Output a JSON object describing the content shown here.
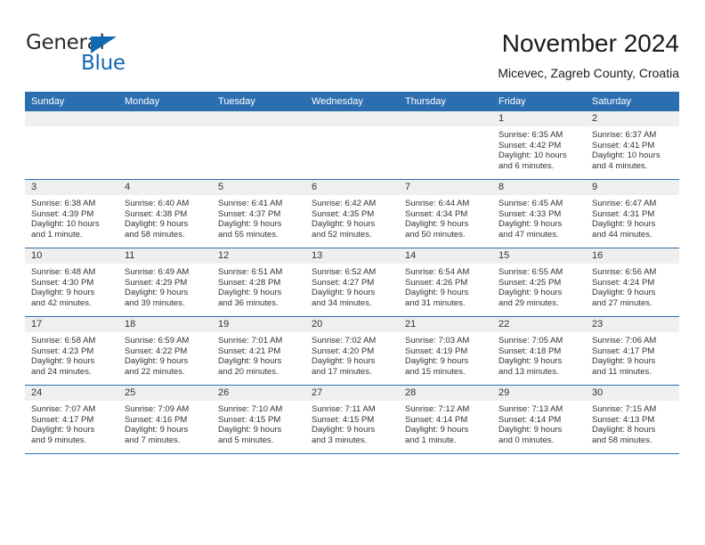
{
  "brand": {
    "name_part1": "General",
    "name_part2": "Blue",
    "triangle_color": "#1268b3"
  },
  "header": {
    "title": "November 2024",
    "subtitle": "Micevec, Zagreb County, Croatia"
  },
  "theme": {
    "header_blue": "#2c6fb1",
    "daybar_gray": "#efefef",
    "text_color": "#333333"
  },
  "labels": {
    "sunrise": "Sunrise:",
    "sunset": "Sunset:",
    "daylight": "Daylight:"
  },
  "weekdays": [
    "Sunday",
    "Monday",
    "Tuesday",
    "Wednesday",
    "Thursday",
    "Friday",
    "Saturday"
  ],
  "weeks": [
    [
      {
        "empty": true
      },
      {
        "empty": true
      },
      {
        "empty": true
      },
      {
        "empty": true
      },
      {
        "empty": true
      },
      {
        "day": "1",
        "sunrise": "Sunrise: 6:35 AM",
        "sunset": "Sunset: 4:42 PM",
        "daylight_l1": "Daylight: 10 hours",
        "daylight_l2": "and 6 minutes."
      },
      {
        "day": "2",
        "sunrise": "Sunrise: 6:37 AM",
        "sunset": "Sunset: 4:41 PM",
        "daylight_l1": "Daylight: 10 hours",
        "daylight_l2": "and 4 minutes."
      }
    ],
    [
      {
        "day": "3",
        "sunrise": "Sunrise: 6:38 AM",
        "sunset": "Sunset: 4:39 PM",
        "daylight_l1": "Daylight: 10 hours",
        "daylight_l2": "and 1 minute."
      },
      {
        "day": "4",
        "sunrise": "Sunrise: 6:40 AM",
        "sunset": "Sunset: 4:38 PM",
        "daylight_l1": "Daylight: 9 hours",
        "daylight_l2": "and 58 minutes."
      },
      {
        "day": "5",
        "sunrise": "Sunrise: 6:41 AM",
        "sunset": "Sunset: 4:37 PM",
        "daylight_l1": "Daylight: 9 hours",
        "daylight_l2": "and 55 minutes."
      },
      {
        "day": "6",
        "sunrise": "Sunrise: 6:42 AM",
        "sunset": "Sunset: 4:35 PM",
        "daylight_l1": "Daylight: 9 hours",
        "daylight_l2": "and 52 minutes."
      },
      {
        "day": "7",
        "sunrise": "Sunrise: 6:44 AM",
        "sunset": "Sunset: 4:34 PM",
        "daylight_l1": "Daylight: 9 hours",
        "daylight_l2": "and 50 minutes."
      },
      {
        "day": "8",
        "sunrise": "Sunrise: 6:45 AM",
        "sunset": "Sunset: 4:33 PM",
        "daylight_l1": "Daylight: 9 hours",
        "daylight_l2": "and 47 minutes."
      },
      {
        "day": "9",
        "sunrise": "Sunrise: 6:47 AM",
        "sunset": "Sunset: 4:31 PM",
        "daylight_l1": "Daylight: 9 hours",
        "daylight_l2": "and 44 minutes."
      }
    ],
    [
      {
        "day": "10",
        "sunrise": "Sunrise: 6:48 AM",
        "sunset": "Sunset: 4:30 PM",
        "daylight_l1": "Daylight: 9 hours",
        "daylight_l2": "and 42 minutes."
      },
      {
        "day": "11",
        "sunrise": "Sunrise: 6:49 AM",
        "sunset": "Sunset: 4:29 PM",
        "daylight_l1": "Daylight: 9 hours",
        "daylight_l2": "and 39 minutes."
      },
      {
        "day": "12",
        "sunrise": "Sunrise: 6:51 AM",
        "sunset": "Sunset: 4:28 PM",
        "daylight_l1": "Daylight: 9 hours",
        "daylight_l2": "and 36 minutes."
      },
      {
        "day": "13",
        "sunrise": "Sunrise: 6:52 AM",
        "sunset": "Sunset: 4:27 PM",
        "daylight_l1": "Daylight: 9 hours",
        "daylight_l2": "and 34 minutes."
      },
      {
        "day": "14",
        "sunrise": "Sunrise: 6:54 AM",
        "sunset": "Sunset: 4:26 PM",
        "daylight_l1": "Daylight: 9 hours",
        "daylight_l2": "and 31 minutes."
      },
      {
        "day": "15",
        "sunrise": "Sunrise: 6:55 AM",
        "sunset": "Sunset: 4:25 PM",
        "daylight_l1": "Daylight: 9 hours",
        "daylight_l2": "and 29 minutes."
      },
      {
        "day": "16",
        "sunrise": "Sunrise: 6:56 AM",
        "sunset": "Sunset: 4:24 PM",
        "daylight_l1": "Daylight: 9 hours",
        "daylight_l2": "and 27 minutes."
      }
    ],
    [
      {
        "day": "17",
        "sunrise": "Sunrise: 6:58 AM",
        "sunset": "Sunset: 4:23 PM",
        "daylight_l1": "Daylight: 9 hours",
        "daylight_l2": "and 24 minutes."
      },
      {
        "day": "18",
        "sunrise": "Sunrise: 6:59 AM",
        "sunset": "Sunset: 4:22 PM",
        "daylight_l1": "Daylight: 9 hours",
        "daylight_l2": "and 22 minutes."
      },
      {
        "day": "19",
        "sunrise": "Sunrise: 7:01 AM",
        "sunset": "Sunset: 4:21 PM",
        "daylight_l1": "Daylight: 9 hours",
        "daylight_l2": "and 20 minutes."
      },
      {
        "day": "20",
        "sunrise": "Sunrise: 7:02 AM",
        "sunset": "Sunset: 4:20 PM",
        "daylight_l1": "Daylight: 9 hours",
        "daylight_l2": "and 17 minutes."
      },
      {
        "day": "21",
        "sunrise": "Sunrise: 7:03 AM",
        "sunset": "Sunset: 4:19 PM",
        "daylight_l1": "Daylight: 9 hours",
        "daylight_l2": "and 15 minutes."
      },
      {
        "day": "22",
        "sunrise": "Sunrise: 7:05 AM",
        "sunset": "Sunset: 4:18 PM",
        "daylight_l1": "Daylight: 9 hours",
        "daylight_l2": "and 13 minutes."
      },
      {
        "day": "23",
        "sunrise": "Sunrise: 7:06 AM",
        "sunset": "Sunset: 4:17 PM",
        "daylight_l1": "Daylight: 9 hours",
        "daylight_l2": "and 11 minutes."
      }
    ],
    [
      {
        "day": "24",
        "sunrise": "Sunrise: 7:07 AM",
        "sunset": "Sunset: 4:17 PM",
        "daylight_l1": "Daylight: 9 hours",
        "daylight_l2": "and 9 minutes."
      },
      {
        "day": "25",
        "sunrise": "Sunrise: 7:09 AM",
        "sunset": "Sunset: 4:16 PM",
        "daylight_l1": "Daylight: 9 hours",
        "daylight_l2": "and 7 minutes."
      },
      {
        "day": "26",
        "sunrise": "Sunrise: 7:10 AM",
        "sunset": "Sunset: 4:15 PM",
        "daylight_l1": "Daylight: 9 hours",
        "daylight_l2": "and 5 minutes."
      },
      {
        "day": "27",
        "sunrise": "Sunrise: 7:11 AM",
        "sunset": "Sunset: 4:15 PM",
        "daylight_l1": "Daylight: 9 hours",
        "daylight_l2": "and 3 minutes."
      },
      {
        "day": "28",
        "sunrise": "Sunrise: 7:12 AM",
        "sunset": "Sunset: 4:14 PM",
        "daylight_l1": "Daylight: 9 hours",
        "daylight_l2": "and 1 minute."
      },
      {
        "day": "29",
        "sunrise": "Sunrise: 7:13 AM",
        "sunset": "Sunset: 4:14 PM",
        "daylight_l1": "Daylight: 9 hours",
        "daylight_l2": "and 0 minutes."
      },
      {
        "day": "30",
        "sunrise": "Sunrise: 7:15 AM",
        "sunset": "Sunset: 4:13 PM",
        "daylight_l1": "Daylight: 8 hours",
        "daylight_l2": "and 58 minutes."
      }
    ]
  ]
}
